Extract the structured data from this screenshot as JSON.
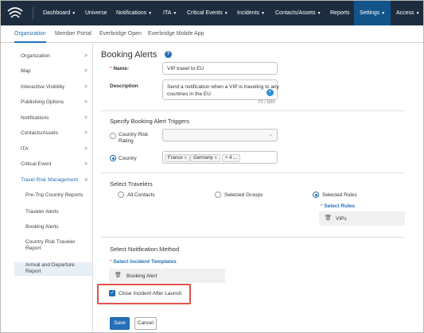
{
  "topnav": {
    "items": [
      {
        "label": "Dashboard",
        "chevron": true
      },
      {
        "label": "Universe",
        "chevron": false
      },
      {
        "label": "Notifications",
        "chevron": true
      },
      {
        "label": "ITA",
        "chevron": true
      },
      {
        "label": "Critical Events",
        "chevron": true
      },
      {
        "label": "Incidents",
        "chevron": true
      },
      {
        "label": "Contacts/Assets",
        "chevron": true
      },
      {
        "label": "Reports",
        "chevron": false
      },
      {
        "label": "Settings",
        "chevron": true,
        "active": true
      },
      {
        "label": "Access",
        "chevron": true
      }
    ]
  },
  "subnav": {
    "items": [
      {
        "label": "Organization",
        "active": true
      },
      {
        "label": "Member Portal"
      },
      {
        "label": "Everbridge Open"
      },
      {
        "label": "Everbridge Mobile App"
      }
    ]
  },
  "sidebar": {
    "items": [
      {
        "label": "Organization",
        "arrow": ">"
      },
      {
        "label": "Map",
        "arrow": ">"
      },
      {
        "label": "Interactive Visibility",
        "arrow": ">"
      },
      {
        "label": "Publishing Options",
        "arrow": ">"
      },
      {
        "label": "Notifications",
        "arrow": ">"
      },
      {
        "label": "Contacts/Assets",
        "arrow": ">"
      },
      {
        "label": "ITA",
        "arrow": ">"
      },
      {
        "label": "Critical Event",
        "arrow": ">"
      },
      {
        "label": "Travel Risk Management",
        "arrow": "v"
      }
    ],
    "subitems": [
      {
        "label": "Pre-Trip Country Reports"
      },
      {
        "label": "Traveler Alerts"
      },
      {
        "label": "Booking Alerts",
        "selected": true
      },
      {
        "label": "Country Risk Traveler Report"
      },
      {
        "label": "Arrival and Departure Report"
      }
    ]
  },
  "page": {
    "title": "Booking Alerts",
    "help_icon": "?"
  },
  "form": {
    "name_required": "*",
    "name_label": "Name:",
    "name_value": "VIP travel to EU",
    "description_label": "Description",
    "description_value": "Send a notification when a VIP is traveling to any countries in the EU",
    "description_counter": "70 / 500"
  },
  "triggers": {
    "title": "Specify Booking Alert Triggers",
    "country_risk_label": "Country Risk Rating",
    "country_label": "Country",
    "country_tags": [
      {
        "label": "France",
        "remove": "x"
      },
      {
        "label": "Germany",
        "remove": "x"
      },
      {
        "label": "+ 4 ...",
        "remove": ""
      }
    ]
  },
  "travelers": {
    "title": "Select Travelers",
    "options": [
      "All Contacts",
      "Selected Groups",
      "Selected Rules"
    ],
    "selected_index": 2,
    "rules_required": "*",
    "rules_label": "Select Rules",
    "rules": [
      "VIPs"
    ]
  },
  "notification": {
    "title": "Select Notification Method",
    "templates_required": "*",
    "templates_label": "Select Incident Templates",
    "templates": [
      "Booking Alert"
    ],
    "close_incident_label": "Close Incident After Launch",
    "close_incident_checked": true
  },
  "actions": {
    "save": "Save",
    "cancel": "Cancel"
  },
  "icons": {
    "logo": "everbridge-logo-icon",
    "help": "help-icon",
    "trash": "trash-icon",
    "check": "check-icon"
  },
  "colors": {
    "topnav_bg": "#1d2d3f",
    "accent": "#2470b8",
    "highlight": "#e0534d",
    "required": "#d0312d"
  }
}
